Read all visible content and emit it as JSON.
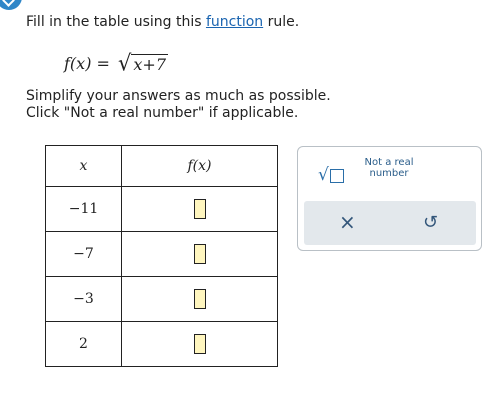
{
  "instruction": {
    "prefix": "Fill in the table using this ",
    "link": "function",
    "suffix": " rule."
  },
  "formula": {
    "lhs": "f(x)",
    "equals": " = ",
    "radicand": "x+7"
  },
  "notes": {
    "line1": "Simplify your answers as much as possible.",
    "line2": "Click \"Not a real number\" if applicable."
  },
  "table": {
    "headers": [
      "x",
      "f(x)"
    ],
    "rows": [
      {
        "x": "−11",
        "fx": ""
      },
      {
        "x": "−7",
        "fx": ""
      },
      {
        "x": "−3",
        "fx": ""
      },
      {
        "x": "2",
        "fx": ""
      }
    ]
  },
  "panel": {
    "sqrt_symbol": "√",
    "not_real_label": "Not a real number",
    "clear_symbol": "×",
    "undo_symbol": "↺"
  },
  "colors": {
    "link": "#1a64b0",
    "answer_box_fill": "#fff6bf",
    "tool_blue": "#2a6ea8",
    "panel_bar": "#e3e8ec"
  }
}
